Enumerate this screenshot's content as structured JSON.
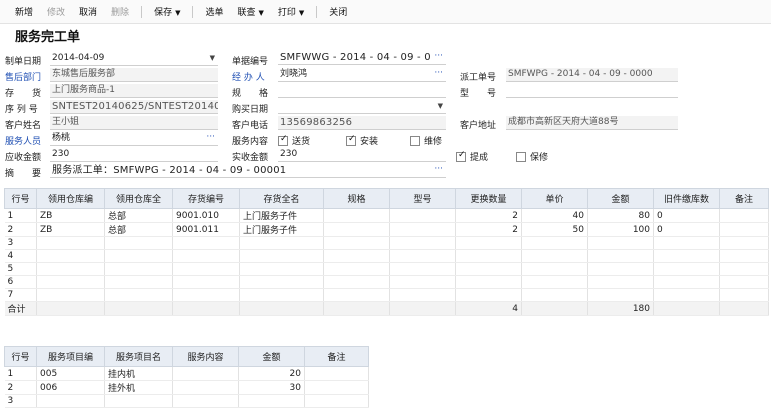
{
  "toolbar": {
    "new": "新增",
    "edit": "修改",
    "cancel": "取消",
    "delete": "删除",
    "save": "保存",
    "select": "选单",
    "linked": "联查",
    "print": "打印",
    "close": "关闭"
  },
  "page_title": "服务完工单",
  "form": {
    "make_date_label": "制单日期",
    "make_date": "2014-04-09",
    "doc_no_label": "单据编号",
    "doc_no": "SMFWWG - 2014 - 04 - 09 - 0",
    "dept_label": "售后部门",
    "dept": "东城售后服务部",
    "handler_label": "经 办 人",
    "handler": "刘晓鸿",
    "dispatch_no_label": "派工单号",
    "dispatch_no": "SMFWPG - 2014 - 04 - 09 - 0000",
    "stock_label": "存　　货",
    "stock": "上门服务商品-1",
    "spec_label": "规　　格",
    "spec": "",
    "model_label": "型　　号",
    "model": "",
    "serial_label": "序 列 号",
    "serial": "SNTEST20140625/SNTEST20140",
    "buy_date_label": "购买日期",
    "buy_date": "",
    "customer_label": "客户姓名",
    "customer": "王小姐",
    "phone_label": "客户电话",
    "phone": "13569863256",
    "address_label": "客户地址",
    "address": "成都市高新区天府大道88号",
    "staff_label": "服务人员",
    "staff": "杨桃",
    "content_label": "服务内容",
    "opt_delivery": "送货",
    "opt_install": "安装",
    "opt_repair": "维修",
    "receivable_label": "应收金额",
    "receivable": "230",
    "actual_label": "实收金额",
    "actual": "230",
    "opt_commission": "提成",
    "opt_warranty": "保修",
    "summary_label": "摘　　要",
    "summary": "服务派工单：SMFWPG - 2014 - 04 - 09 - 00001"
  },
  "grid1": {
    "headers": [
      "行号",
      "领用仓库编",
      "领用仓库全",
      "存货编号",
      "存货全名",
      "规格",
      "型号",
      "更换数量",
      "单价",
      "金额",
      "旧件缴库数",
      "备注"
    ],
    "rows": [
      [
        "1",
        "ZB",
        "总部",
        "9001.010",
        "上门服务子件",
        "",
        "",
        "2",
        "40",
        "80",
        "0",
        ""
      ],
      [
        "2",
        "ZB",
        "总部",
        "9001.011",
        "上门服务子件",
        "",
        "",
        "2",
        "50",
        "100",
        "0",
        ""
      ],
      [
        "3",
        "",
        "",
        "",
        "",
        "",
        "",
        "",
        "",
        "",
        "",
        ""
      ],
      [
        "4",
        "",
        "",
        "",
        "",
        "",
        "",
        "",
        "",
        "",
        "",
        ""
      ],
      [
        "5",
        "",
        "",
        "",
        "",
        "",
        "",
        "",
        "",
        "",
        "",
        ""
      ],
      [
        "6",
        "",
        "",
        "",
        "",
        "",
        "",
        "",
        "",
        "",
        "",
        ""
      ],
      [
        "7",
        "",
        "",
        "",
        "",
        "",
        "",
        "",
        "",
        "",
        "",
        ""
      ]
    ],
    "sum_label": "合计",
    "sum_qty": "4",
    "sum_amount": "180"
  },
  "grid2": {
    "headers": [
      "行号",
      "服务项目编",
      "服务项目名",
      "服务内容",
      "金额",
      "备注"
    ],
    "rows": [
      [
        "1",
        "005",
        "挂内机",
        "",
        "20",
        ""
      ],
      [
        "2",
        "006",
        "挂外机",
        "",
        "30",
        ""
      ],
      [
        "3",
        "",
        "",
        "",
        "",
        ""
      ]
    ]
  }
}
